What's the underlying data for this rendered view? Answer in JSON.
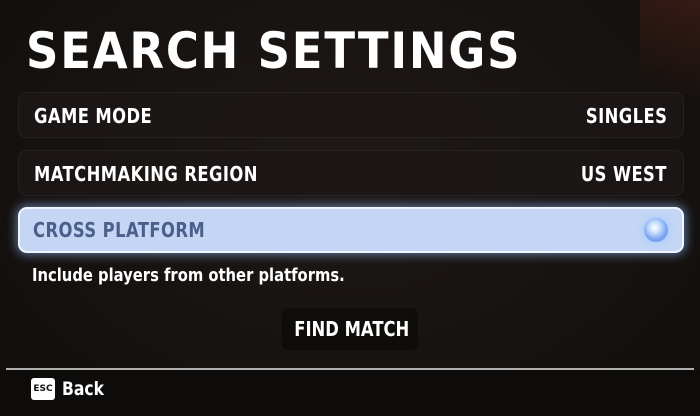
{
  "title": "SEARCH SETTINGS",
  "settings": [
    {
      "label": "GAME MODE",
      "value": "SINGLES"
    },
    {
      "label": "MATCHMAKING REGION",
      "value": "US WEST"
    },
    {
      "label": "CROSS PLATFORM",
      "value": null,
      "toggle_on": true
    }
  ],
  "selected_setting": "CROSS PLATFORM",
  "description": "Include players from other platforms.",
  "find_match_label": "FIND MATCH",
  "footer": {
    "esc_key": "ESC",
    "back_label": "Back"
  },
  "colors": {
    "background": "#161311",
    "selected_row": "#c4d6f4",
    "selected_text": "#4a5f8a",
    "toggle": "#7aa7f0"
  },
  "icons": [
    "esc-key-icon",
    "toggle-on-icon"
  ]
}
